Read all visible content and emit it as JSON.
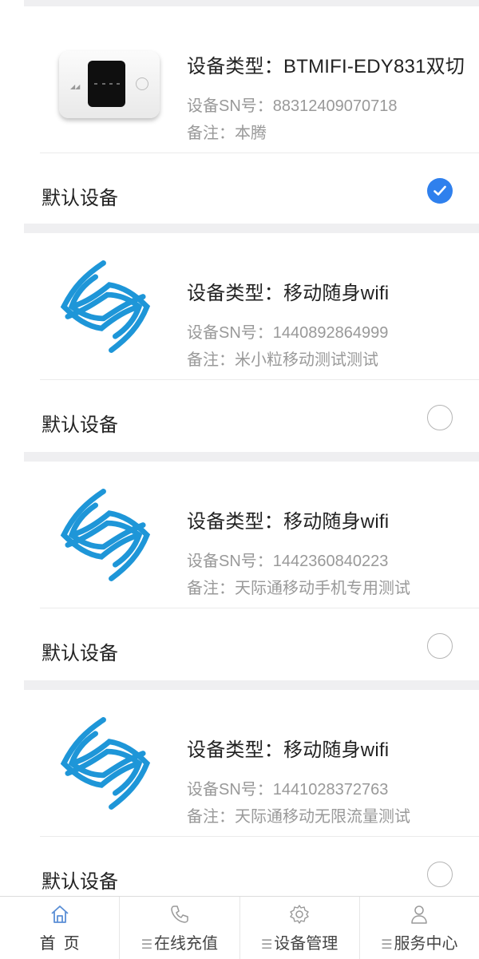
{
  "devices": [
    {
      "type_label": "设备类型：",
      "type_value": "BTMIFI-EDY831双切",
      "sn_label": "设备SN号：",
      "sn_value": "88312409070718",
      "note_label": "备注：",
      "note_value": "本腾",
      "default_label": "默认设备",
      "selected": true,
      "icon": "portable-router-image"
    },
    {
      "type_label": "设备类型：",
      "type_value": "移动随身wifi",
      "sn_label": "设备SN号：",
      "sn_value": "1440892864999",
      "note_label": "备注：",
      "note_value": "米小粒移动测试测试",
      "default_label": "默认设备",
      "selected": false,
      "icon": "china-mobile-logo"
    },
    {
      "type_label": "设备类型：",
      "type_value": "移动随身wifi",
      "sn_label": "设备SN号：",
      "sn_value": "1442360840223",
      "note_label": "备注：",
      "note_value": "天际通移动手机专用测试",
      "default_label": "默认设备",
      "selected": false,
      "icon": "china-mobile-logo"
    },
    {
      "type_label": "设备类型：",
      "type_value": "移动随身wifi",
      "sn_label": "设备SN号：",
      "sn_value": "1441028372763",
      "note_label": "备注：",
      "note_value": "天际通移动无限流量测试",
      "default_label": "默认设备",
      "selected": false,
      "icon": "china-mobile-logo"
    }
  ],
  "tabbar": {
    "tabs": [
      {
        "label": "首页",
        "icon": "home-icon",
        "active": true
      },
      {
        "label": "在线充值",
        "icon": "phone-icon",
        "active": false
      },
      {
        "label": "设备管理",
        "icon": "gear-icon",
        "active": false
      },
      {
        "label": "服务中心",
        "icon": "person-icon",
        "active": false
      }
    ]
  },
  "colors": {
    "accent": "#2f80ed",
    "logo_blue": "#1e96d8",
    "separator": "#efeff1",
    "muted_text": "#999999"
  }
}
